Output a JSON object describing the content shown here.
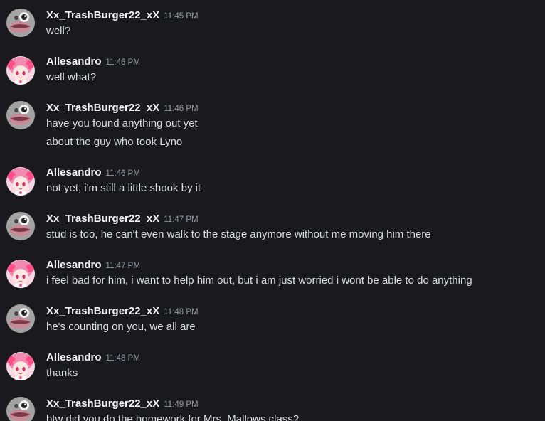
{
  "colors": {
    "background": "#1a1a1e",
    "username": "#f2f3f5",
    "timestamp": "#949ba4",
    "message_text": "#dbdee1"
  },
  "messages": [
    {
      "author": "Xx_TrashBurger22_xX",
      "avatar": "lips-avatar-icon",
      "time": "11:45 PM",
      "lines": [
        "well?"
      ]
    },
    {
      "author": "Allesandro",
      "avatar": "pink-anime-girl-avatar-icon",
      "time": "11:46 PM",
      "lines": [
        "well what?"
      ]
    },
    {
      "author": "Xx_TrashBurger22_xX",
      "avatar": "lips-avatar-icon",
      "time": "11:46 PM",
      "lines": [
        "have you found anything out yet",
        "about the guy who took Lyno"
      ]
    },
    {
      "author": "Allesandro",
      "avatar": "pink-anime-girl-avatar-icon",
      "time": "11:46 PM",
      "lines": [
        "not yet, i'm still a little shook by it"
      ]
    },
    {
      "author": "Xx_TrashBurger22_xX",
      "avatar": "lips-avatar-icon",
      "time": "11:47 PM",
      "lines": [
        "stud is too, he can't even walk to the stage anymore without me moving him there"
      ]
    },
    {
      "author": "Allesandro",
      "avatar": "pink-anime-girl-avatar-icon",
      "time": "11:47 PM",
      "lines": [
        "i feel bad for him, i want to help him out, but i am just worried i wont be able to do anything"
      ]
    },
    {
      "author": "Xx_TrashBurger22_xX",
      "avatar": "lips-avatar-icon",
      "time": "11:48 PM",
      "lines": [
        "he's counting on you, we all are"
      ]
    },
    {
      "author": "Allesandro",
      "avatar": "pink-anime-girl-avatar-icon",
      "time": "11:48 PM",
      "lines": [
        "thanks"
      ]
    },
    {
      "author": "Xx_TrashBurger22_xX",
      "avatar": "lips-avatar-icon",
      "time": "11:49 PM",
      "lines": [
        "btw did you do the homework for Mrs. Mallows class?"
      ]
    }
  ]
}
